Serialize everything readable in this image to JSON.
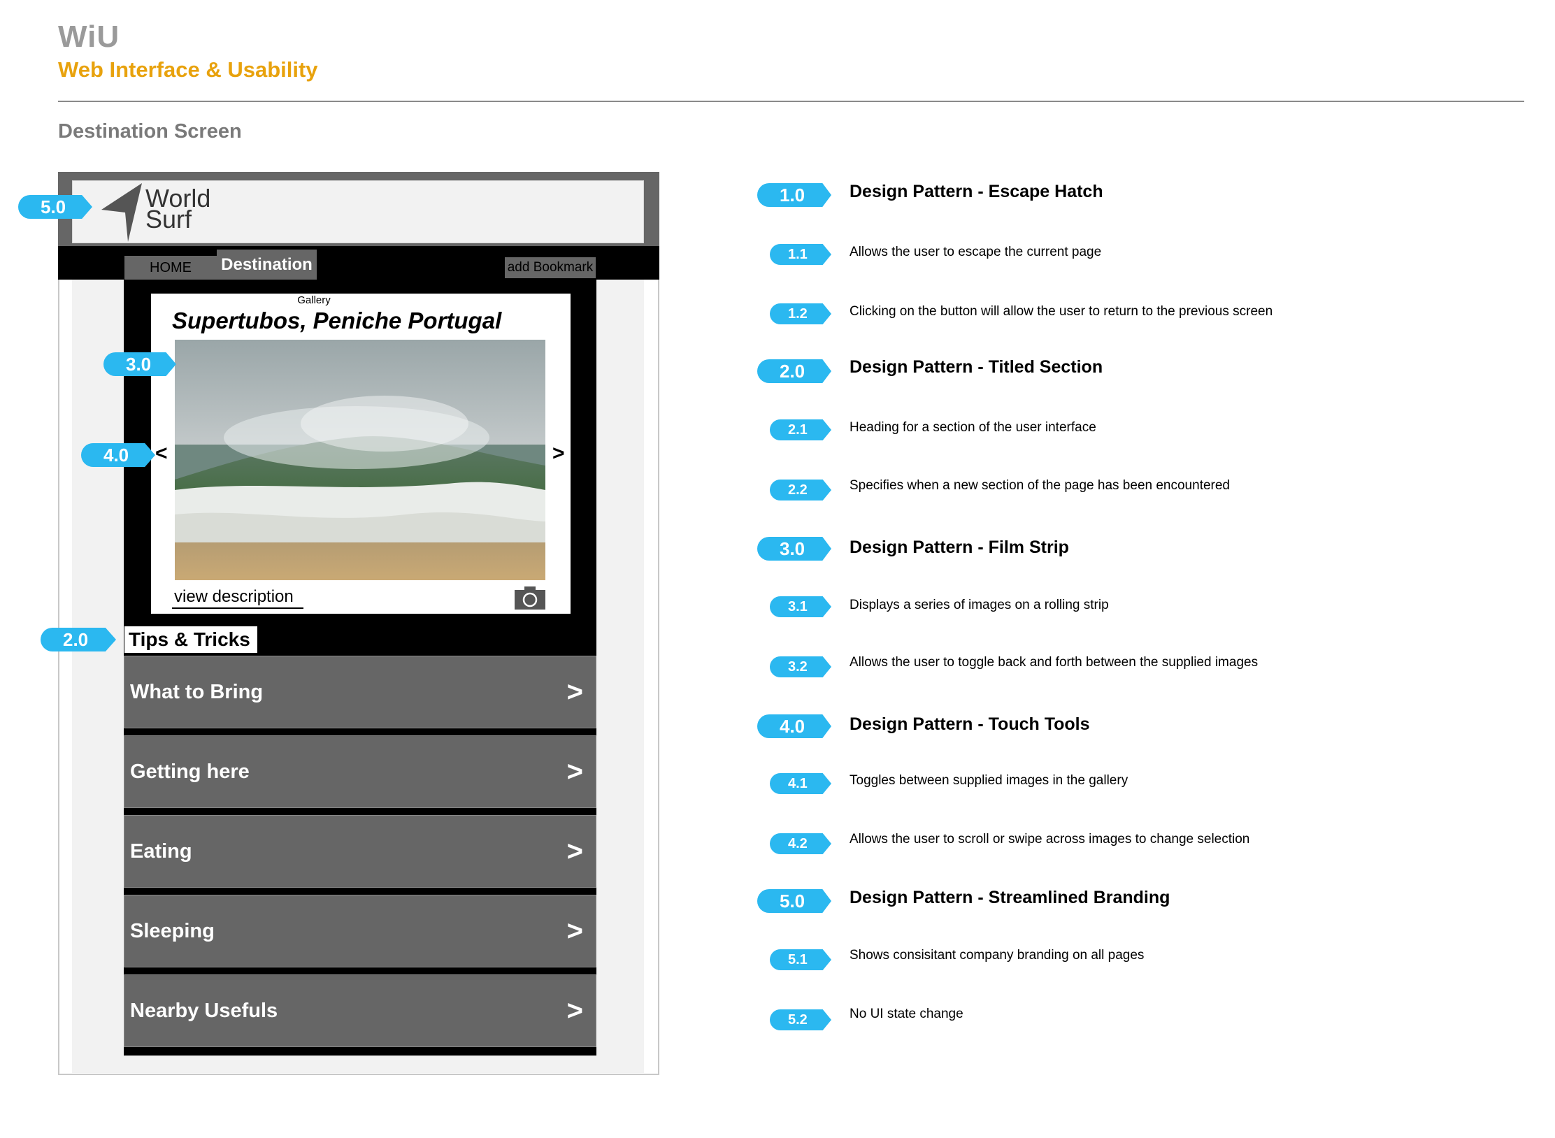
{
  "header": {
    "brand": "WiU",
    "subtitle": "Web Interface & Usability",
    "screen_title": "Destination Screen"
  },
  "colors": {
    "accent": "#e8a20d",
    "callout": "#2bb8f0",
    "panel": "#666666"
  },
  "mockup": {
    "logo_line1": "World",
    "logo_line2": "Surf",
    "nav": {
      "home": "HOME",
      "destination": "Destination",
      "bookmark": "add Bookmark"
    },
    "gallery": {
      "label": "Gallery",
      "title": "Supertubos, Peniche Portugal",
      "prev": "<",
      "next": ">",
      "view_description": "view description",
      "camera_icon": "camera-icon"
    },
    "section_heading": "Tips & Tricks",
    "rows": [
      {
        "label": "What to Bring",
        "chevron": ">"
      },
      {
        "label": "Getting here",
        "chevron": ">"
      },
      {
        "label": "Eating",
        "chevron": ">"
      },
      {
        "label": "Sleeping",
        "chevron": ">"
      },
      {
        "label": "Nearby Usefuls",
        "chevron": ">"
      }
    ],
    "callouts": {
      "branding": "5.0",
      "film_strip": "3.0",
      "touch_tools": "4.0",
      "titled_section": "2.0"
    }
  },
  "patterns": [
    {
      "num": "1.0",
      "title": "Design Pattern - Escape Hatch",
      "items": [
        {
          "num": "1.1",
          "text": "Allows the user to escape the current page"
        },
        {
          "num": "1.2",
          "text": "Clicking on the button will allow the user to return to the previous screen"
        }
      ]
    },
    {
      "num": "2.0",
      "title": "Design Pattern - Titled Section",
      "items": [
        {
          "num": "2.1",
          "text": "Heading for a section of the user interface"
        },
        {
          "num": "2.2",
          "text": "Specifies when a new section of the page has been encountered"
        }
      ]
    },
    {
      "num": "3.0",
      "title": "Design Pattern - Film Strip",
      "items": [
        {
          "num": "3.1",
          "text": "Displays a series of images on a rolling strip"
        },
        {
          "num": "3.2",
          "text": "Allows the user to toggle back and forth between the supplied images"
        }
      ]
    },
    {
      "num": "4.0",
      "title": "Design Pattern - Touch Tools",
      "items": [
        {
          "num": "4.1",
          "text": "Toggles between supplied images in the gallery"
        },
        {
          "num": "4.2",
          "text": "Allows the user to scroll or swipe across images to change selection"
        }
      ]
    },
    {
      "num": "5.0",
      "title": "Design Pattern - Streamlined Branding",
      "items": [
        {
          "num": "5.1",
          "text": "Shows consisitant company branding on all pages"
        },
        {
          "num": "5.2",
          "text": "No UI state change"
        }
      ]
    }
  ]
}
